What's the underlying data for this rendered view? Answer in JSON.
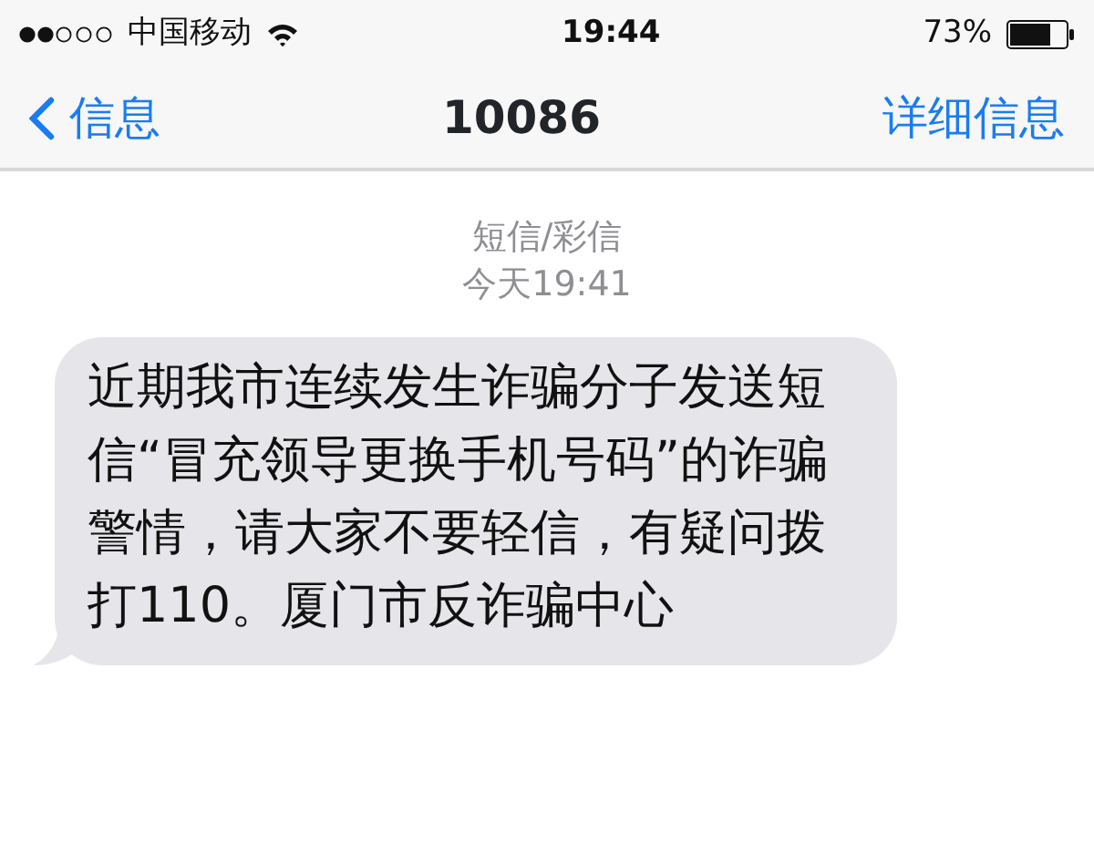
{
  "status_bar": {
    "carrier": "中国移动",
    "time": "19:44",
    "battery": "73%"
  },
  "nav_bar": {
    "back": "信息",
    "title": "10086",
    "details": "详细信息"
  },
  "thread": {
    "label": "短信/彩信",
    "timestamp": "今天19:41",
    "messages": [
      {
        "text": "近期我市连续发生诈骗分子发送短信“冒充领导更换手机号码”的诈骗警情，请大家不要轻信，有疑问拨打110。厦门市反诈骗中心"
      }
    ]
  }
}
